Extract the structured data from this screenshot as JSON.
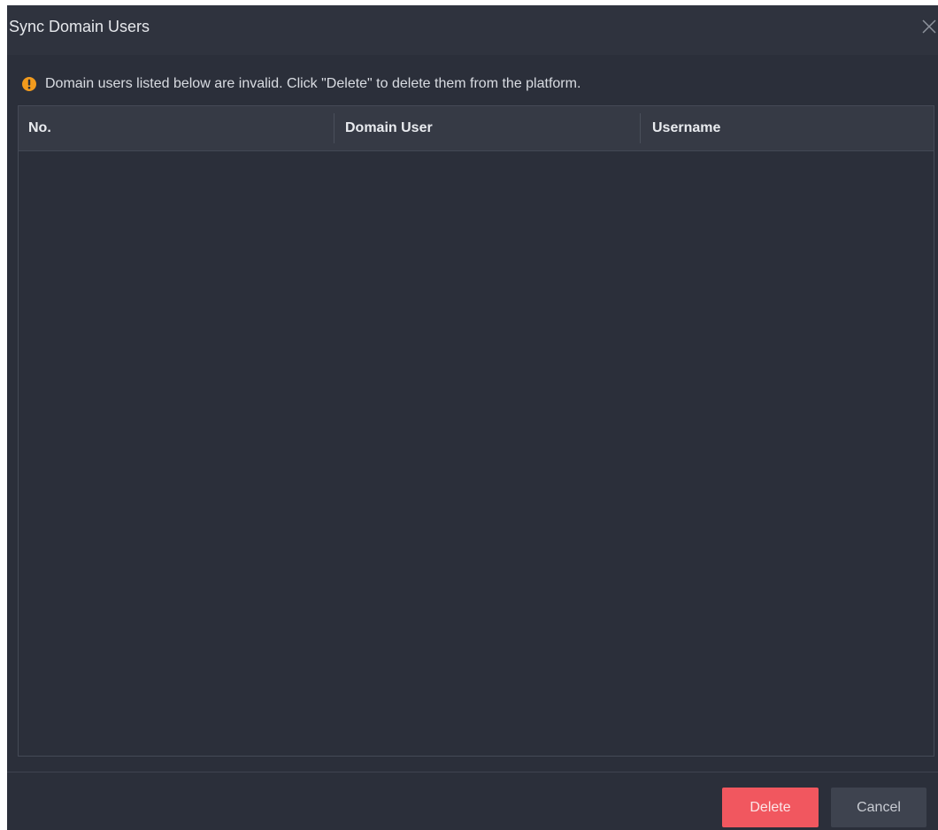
{
  "dialog": {
    "title": "Sync Domain Users",
    "close_icon": "close-icon"
  },
  "notice": {
    "icon": "warning-icon",
    "icon_color": "#f29b1d",
    "text": "Domain users listed below are invalid. Click \"Delete\" to delete them from the platform."
  },
  "table": {
    "columns": [
      "No.",
      "Domain User",
      "Username"
    ],
    "rows": []
  },
  "footer": {
    "delete_label": "Delete",
    "cancel_label": "Cancel",
    "delete_color": "#f1575f"
  }
}
